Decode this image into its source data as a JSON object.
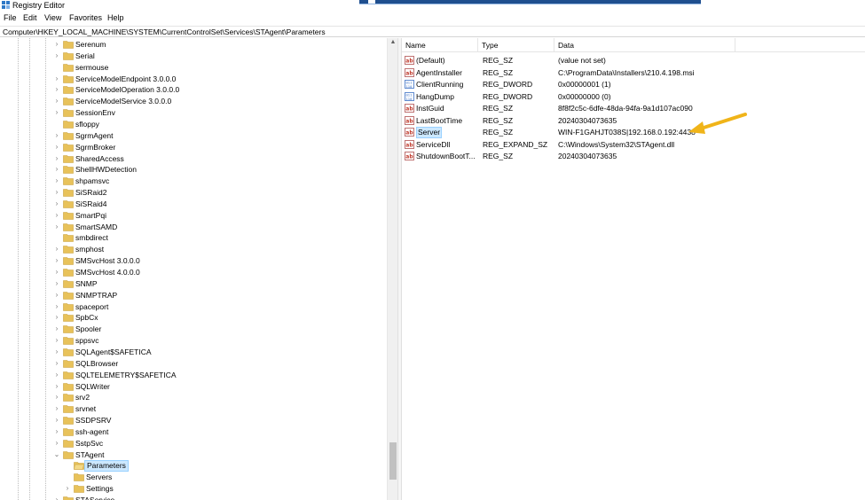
{
  "window": {
    "title": "Registry Editor"
  },
  "menu": [
    "File",
    "Edit",
    "View",
    "Favorites",
    "Help"
  ],
  "address": "Computer\\HKEY_LOCAL_MACHINE\\SYSTEM\\CurrentControlSet\\Services\\STAgent\\Parameters",
  "tree": {
    "items": [
      {
        "label": "Serenum",
        "expandable": true
      },
      {
        "label": "Serial",
        "expandable": true
      },
      {
        "label": "sermouse",
        "expandable": false
      },
      {
        "label": "ServiceModelEndpoint 3.0.0.0",
        "expandable": true
      },
      {
        "label": "ServiceModelOperation 3.0.0.0",
        "expandable": true
      },
      {
        "label": "ServiceModelService 3.0.0.0",
        "expandable": true
      },
      {
        "label": "SessionEnv",
        "expandable": true
      },
      {
        "label": "sfloppy",
        "expandable": false
      },
      {
        "label": "SgrmAgent",
        "expandable": true
      },
      {
        "label": "SgrmBroker",
        "expandable": true
      },
      {
        "label": "SharedAccess",
        "expandable": true
      },
      {
        "label": "ShellHWDetection",
        "expandable": true
      },
      {
        "label": "shpamsvc",
        "expandable": true
      },
      {
        "label": "SiSRaid2",
        "expandable": true
      },
      {
        "label": "SiSRaid4",
        "expandable": true
      },
      {
        "label": "SmartPqi",
        "expandable": true
      },
      {
        "label": "SmartSAMD",
        "expandable": true
      },
      {
        "label": "smbdirect",
        "expandable": false
      },
      {
        "label": "smphost",
        "expandable": true
      },
      {
        "label": "SMSvcHost 3.0.0.0",
        "expandable": true
      },
      {
        "label": "SMSvcHost 4.0.0.0",
        "expandable": true
      },
      {
        "label": "SNMP",
        "expandable": true
      },
      {
        "label": "SNMPTRAP",
        "expandable": true
      },
      {
        "label": "spaceport",
        "expandable": true
      },
      {
        "label": "SpbCx",
        "expandable": true
      },
      {
        "label": "Spooler",
        "expandable": true
      },
      {
        "label": "sppsvc",
        "expandable": true
      },
      {
        "label": "SQLAgent$SAFETICA",
        "expandable": true
      },
      {
        "label": "SQLBrowser",
        "expandable": true
      },
      {
        "label": "SQLTELEMETRY$SAFETICA",
        "expandable": true
      },
      {
        "label": "SQLWriter",
        "expandable": true
      },
      {
        "label": "srv2",
        "expandable": true
      },
      {
        "label": "srvnet",
        "expandable": true
      },
      {
        "label": "SSDPSRV",
        "expandable": true
      },
      {
        "label": "ssh-agent",
        "expandable": true
      },
      {
        "label": "SstpSvc",
        "expandable": true
      },
      {
        "label": "STAgent",
        "expandable": true,
        "expanded": true
      },
      {
        "label": "Parameters",
        "expandable": false,
        "child": true,
        "selected": true
      },
      {
        "label": "Servers",
        "expandable": false,
        "child": true
      },
      {
        "label": "Settings",
        "expandable": true,
        "child": true
      },
      {
        "label": "STAService",
        "expandable": true
      }
    ]
  },
  "list": {
    "columns": [
      "Name",
      "Type",
      "Data"
    ],
    "rows": [
      {
        "icon": "string-value-icon",
        "name": "(Default)",
        "type": "REG_SZ",
        "data": "(value not set)"
      },
      {
        "icon": "string-value-icon",
        "name": "AgentInstaller",
        "type": "REG_SZ",
        "data": "C:\\ProgramData\\Installers\\210.4.198.msi"
      },
      {
        "icon": "binary-value-icon",
        "name": "ClientRunning",
        "type": "REG_DWORD",
        "data": "0x00000001 (1)"
      },
      {
        "icon": "binary-value-icon",
        "name": "HangDump",
        "type": "REG_DWORD",
        "data": "0x00000000 (0)"
      },
      {
        "icon": "string-value-icon",
        "name": "InstGuid",
        "type": "REG_SZ",
        "data": "8f8f2c5c-6dfe-48da-94fa-9a1d107ac090"
      },
      {
        "icon": "string-value-icon",
        "name": "LastBootTime",
        "type": "REG_SZ",
        "data": "20240304073635"
      },
      {
        "icon": "string-value-icon",
        "name": "Server",
        "type": "REG_SZ",
        "data": "WIN-F1GAHJT038S|192.168.0.192:4438",
        "selected": true
      },
      {
        "icon": "string-value-icon",
        "name": "ServiceDll",
        "type": "REG_EXPAND_SZ",
        "data": "C:\\Windows\\System32\\STAgent.dll"
      },
      {
        "icon": "string-value-icon",
        "name": "ShutdownBootT...",
        "type": "REG_SZ",
        "data": "20240304073635"
      }
    ]
  },
  "colors": {
    "selection_bg": "#cce8ff",
    "selection_border": "#99d1ff",
    "annotation_arrow": "#f0b419",
    "folder": "#e8c25a"
  }
}
